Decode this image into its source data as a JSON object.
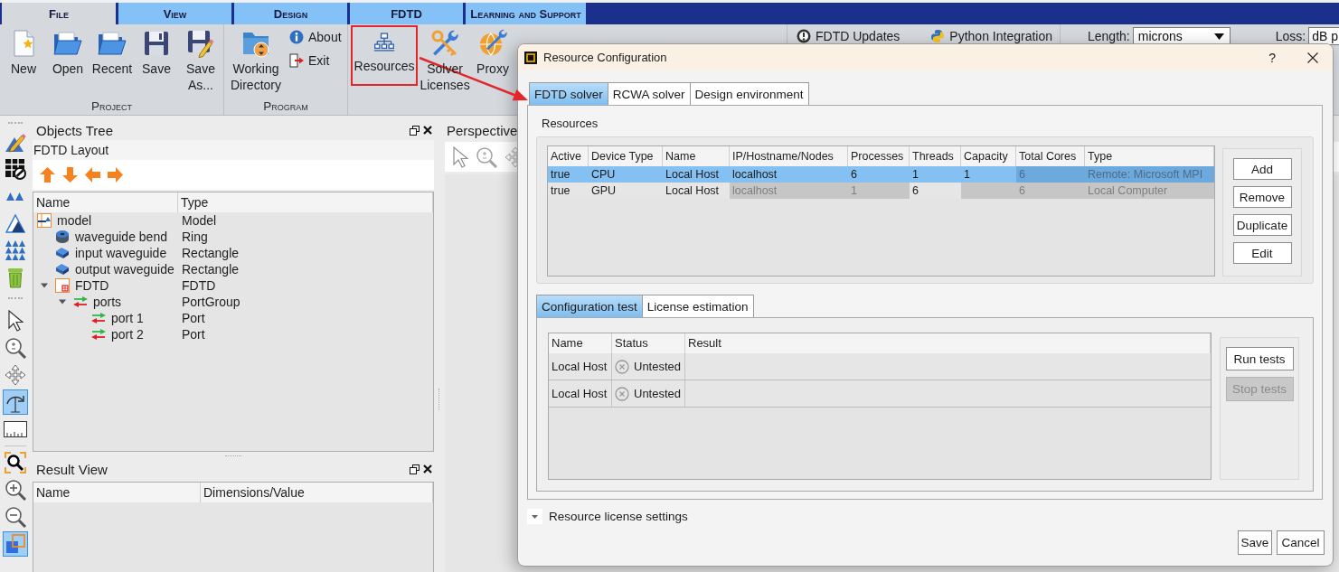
{
  "ribbon_tabs": [
    {
      "label": "File",
      "selected": true
    },
    {
      "label": "View",
      "selected": false
    },
    {
      "label": "Design",
      "selected": false
    },
    {
      "label": "FDTD",
      "selected": false
    },
    {
      "label": "Learning and Support",
      "selected": false
    }
  ],
  "ribbon_groups": [
    {
      "kind": "large",
      "label": "Project",
      "buttons": [
        {
          "kind": "new",
          "label": "New"
        },
        {
          "kind": "open",
          "label": "Open"
        },
        {
          "kind": "recent",
          "label": "Recent"
        },
        {
          "kind": "save",
          "label": "Save"
        },
        {
          "kind": "save_as",
          "label": "Save As..."
        }
      ]
    },
    {
      "kind": "mixed",
      "label": "Program",
      "buttons": [
        {
          "kind": "folder",
          "label": "Working Directory"
        }
      ],
      "small_buttons": [
        {
          "kind": "about",
          "label": "About"
        },
        {
          "kind": "exit",
          "label": "Exit"
        }
      ]
    },
    {
      "kind": "large",
      "buttons": [
        {
          "kind": "resources",
          "label": "Resources",
          "highlighted": true
        },
        {
          "kind": "licenses",
          "label": "Solver Licenses",
          "highlighted": false
        },
        {
          "kind": "proxy",
          "label": "Proxy",
          "highlighted": false
        }
      ]
    },
    {
      "kind": "small",
      "small_buttons": [
        {
          "kind": "updates",
          "label": "FDTD Updates"
        },
        {
          "kind": "python",
          "label": "Python Integration"
        }
      ]
    },
    {
      "kind": "units",
      "fields": [
        {
          "kind": "select",
          "label": "Length:",
          "value": "microns"
        },
        {
          "kind": "input",
          "label": "Loss:",
          "value": "dB p"
        }
      ]
    }
  ],
  "tool_groups": [
    [
      {
        "kind": "pencil",
        "selected": false
      },
      {
        "kind": "table",
        "selected": false
      },
      {
        "kind": "triangles",
        "selected": false
      },
      {
        "kind": "pyramid",
        "selected": false
      },
      {
        "kind": "triangle_grid",
        "selected": false
      },
      {
        "kind": "trash",
        "selected": false
      }
    ],
    [
      {
        "kind": "cursor",
        "selected": false
      },
      {
        "kind": "zoom",
        "selected": false
      },
      {
        "kind": "move",
        "selected": false
      },
      {
        "kind": "rotate",
        "selected": true
      },
      {
        "kind": "ruler",
        "selected": false
      }
    ],
    [
      {
        "kind": "zoom_region",
        "selected": false
      },
      {
        "kind": "zoom_in",
        "selected": false
      },
      {
        "kind": "zoom_out",
        "selected": false
      },
      {
        "kind": "view_squares",
        "selected": true
      }
    ]
  ],
  "objects_tree": {
    "title": "Objects Tree",
    "subtitle": "FDTD Layout",
    "columns": [
      "Name",
      "Type"
    ],
    "items": [
      {
        "kind": "model",
        "name": "model",
        "type": "Model",
        "children": [
          {
            "kind": "ring",
            "name": "waveguide bend",
            "type": "Ring"
          },
          {
            "kind": "rectangle",
            "name": "input waveguide",
            "type": "Rectangle"
          },
          {
            "kind": "rectangle",
            "name": "output waveguide",
            "type": "Rectangle"
          },
          {
            "kind": "fdtd",
            "name": "FDTD",
            "type": "FDTD",
            "expanded": true,
            "children": [
              {
                "kind": "port",
                "name": "ports",
                "type": "PortGroup",
                "expanded": true,
                "children": [
                  {
                    "kind": "port",
                    "name": "port 1",
                    "type": "Port"
                  },
                  {
                    "kind": "port",
                    "name": "port 2",
                    "type": "Port"
                  }
                ]
              }
            ]
          }
        ]
      }
    ]
  },
  "result_view": {
    "title": "Result View",
    "columns": [
      "Name",
      "Dimensions/Value"
    ]
  },
  "perspective": {
    "title": "Perspective"
  },
  "dialog": {
    "title": "Resource Configuration",
    "help": "?",
    "tabs": [
      {
        "label": "FDTD solver",
        "selected": true
      },
      {
        "label": "RCWA solver",
        "selected": false
      },
      {
        "label": "Design environment",
        "selected": false
      }
    ],
    "resources": {
      "label": "Resources",
      "columns": [
        "Active",
        "Device Type",
        "Name",
        "IP/Hostname/Nodes",
        "Processes",
        "Threads",
        "Capacity",
        "Total Cores",
        "Type"
      ],
      "rows": [
        {
          "selected": true,
          "cells": [
            {
              "text": "true",
              "disabled": false
            },
            {
              "text": "CPU",
              "disabled": false
            },
            {
              "text": "Local Host",
              "disabled": false
            },
            {
              "text": "localhost",
              "disabled": false
            },
            {
              "text": "6",
              "disabled": false
            },
            {
              "text": "1",
              "disabled": false
            },
            {
              "text": "1",
              "disabled": false
            },
            {
              "text": "6",
              "disabled": true
            },
            {
              "text": "Remote: Microsoft MPI",
              "disabled": true
            }
          ]
        },
        {
          "selected": false,
          "cells": [
            {
              "text": "true",
              "disabled": false
            },
            {
              "text": "GPU",
              "disabled": false
            },
            {
              "text": "Local Host",
              "disabled": false
            },
            {
              "text": "localhost",
              "disabled": true
            },
            {
              "text": "1",
              "disabled": true
            },
            {
              "text": "6",
              "disabled": false
            },
            {
              "disabled": true
            },
            {
              "text": "6",
              "disabled": true
            },
            {
              "text": "Local Computer",
              "disabled": true
            }
          ]
        }
      ],
      "buttons": [
        "Add",
        "Remove",
        "Duplicate",
        "Edit"
      ]
    },
    "test_tabs": [
      {
        "label": "Configuration test",
        "selected": true
      },
      {
        "label": "License estimation",
        "selected": false
      }
    ],
    "tests": {
      "columns": [
        "Name",
        "Status",
        "Result"
      ],
      "rows": [
        {
          "name": "Local Host",
          "status": "Untested"
        },
        {
          "name": "Local Host",
          "status": "Untested"
        }
      ],
      "buttons": [
        {
          "label": "Run tests",
          "disabled": false
        },
        {
          "label": "Stop tests",
          "disabled": true
        }
      ]
    },
    "license_settings": {
      "label": "Resource license settings"
    },
    "buttons": [
      "Save",
      "Cancel"
    ]
  }
}
